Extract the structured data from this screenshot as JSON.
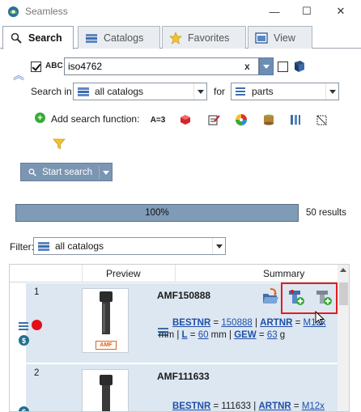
{
  "window": {
    "title": "Seamless",
    "min": "—",
    "max": "☐",
    "close": "✕"
  },
  "tabs": [
    {
      "label": "Search",
      "active": true
    },
    {
      "label": "Catalogs",
      "active": false
    },
    {
      "label": "Favorites",
      "active": false
    },
    {
      "label": "View",
      "active": false
    }
  ],
  "search": {
    "abc_label": "ABC",
    "query": "iso4762",
    "clear": "x",
    "search_in_label": "Search in",
    "search_in_value": "all catalogs",
    "for_label": "for",
    "for_value": "parts",
    "add_function_label": "Add search function:",
    "start_label": "Start search",
    "fn_text_icon": "A=3"
  },
  "progress": {
    "percent": 100,
    "text": "100%",
    "results": "50 results"
  },
  "filter": {
    "label": "Filter:",
    "value": "all catalogs"
  },
  "table": {
    "columns": [
      "Preview",
      "Summary"
    ],
    "rows": [
      {
        "num": "1",
        "title": "AMF150888",
        "line1": {
          "k1": "BESTNR",
          "eq1": " = ",
          "v1": "150888",
          "sep": " | ",
          "k2": "ARTNR",
          "eq2": " = ",
          "v2": "M12x"
        },
        "line2": {
          "unit1": "mm | ",
          "k3": "L",
          "eq3": " = ",
          "v3": "60",
          "unit2": " mm | ",
          "k4": "GEW",
          "eq4": " = ",
          "v4": "63",
          "unit3": " g"
        },
        "brand": "AMF"
      },
      {
        "num": "2",
        "title": "AMF111633",
        "line1": {
          "k1": "BESTNR",
          "eq1": " = ",
          "v1": "111633",
          "sep": " | ",
          "k2": "ARTNR",
          "eq2": " = ",
          "v2": "M12x"
        }
      }
    ]
  },
  "colors": {
    "accent": "#7f9bb6",
    "highlight": "#e61c1c",
    "row_bg": "#dde7f1",
    "link": "#1f4fa8"
  }
}
